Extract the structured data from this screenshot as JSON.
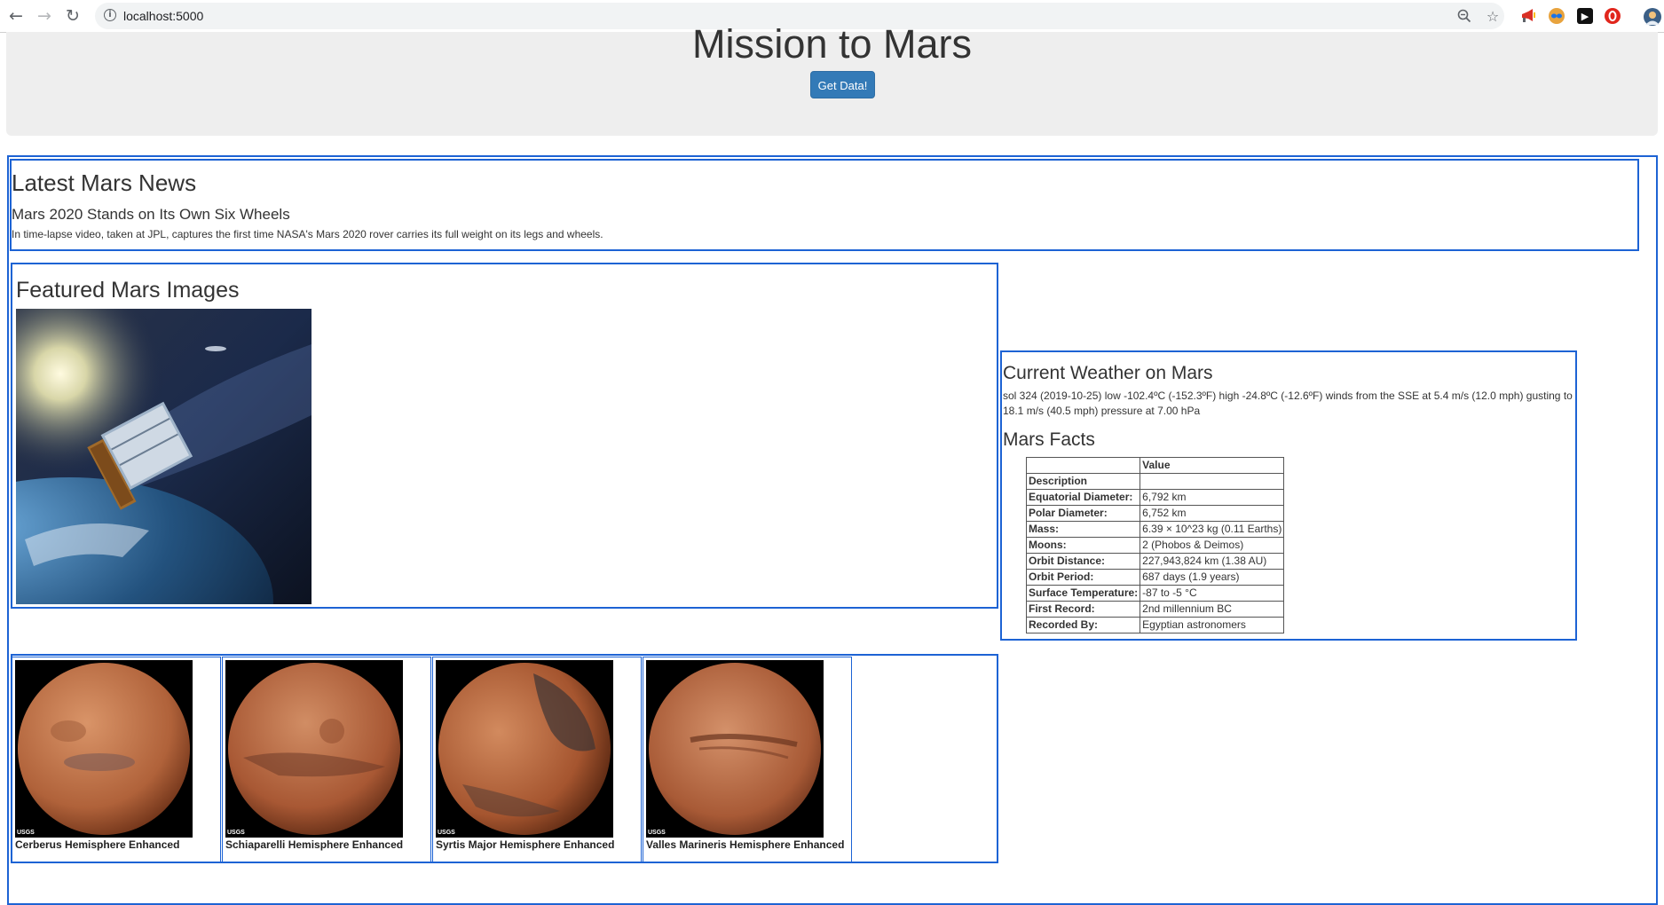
{
  "browser": {
    "url": "localhost:5000",
    "icons": [
      "back-icon",
      "forward-icon",
      "reload-icon",
      "site-info-icon",
      "zoom-icon",
      "bookmark-star-icon"
    ],
    "extensions": [
      "megaphone-extension-icon",
      "mask-extension-icon",
      "youtube-extension-icon",
      "opera-extension-icon",
      "profile-avatar-icon"
    ]
  },
  "header": {
    "title": "Mission to Mars",
    "button_label": "Get Data!",
    "button_color": "#337ab7"
  },
  "news": {
    "heading": "Latest Mars News",
    "title": "Mars 2020 Stands on Its Own Six Wheels",
    "paragraph": "In time-lapse video, taken at JPL, captures the first time NASA's Mars 2020 rover carries its full weight on its legs and wheels."
  },
  "featured": {
    "heading": "Featured Mars Images"
  },
  "weather": {
    "heading": "Current Weather on Mars",
    "text": "sol 324 (2019-10-25) low -102.4ºC (-152.3ºF) high -24.8ºC (-12.6ºF) winds from the SSE at 5.4 m/s (12.0 mph) gusting to 18.1 m/s (40.5 mph) pressure at 7.00 hPa"
  },
  "facts": {
    "heading": "Mars Facts",
    "column_header": "Value",
    "index_label": "Description",
    "rows": [
      {
        "key": "Equatorial Diameter:",
        "value": "6,792 km"
      },
      {
        "key": "Polar Diameter:",
        "value": "6,752 km"
      },
      {
        "key": "Mass:",
        "value": "6.39 × 10^23 kg (0.11 Earths)"
      },
      {
        "key": "Moons:",
        "value": "2 (Phobos & Deimos)"
      },
      {
        "key": "Orbit Distance:",
        "value": "227,943,824 km (1.38 AU)"
      },
      {
        "key": "Orbit Period:",
        "value": "687 days (1.9 years)"
      },
      {
        "key": "Surface Temperature:",
        "value": "-87 to -5 °C"
      },
      {
        "key": "First Record:",
        "value": "2nd millennium BC"
      },
      {
        "key": "Recorded By:",
        "value": "Egyptian astronomers"
      }
    ]
  },
  "hemispheres": [
    {
      "title": "Cerberus Hemisphere Enhanced",
      "logo": "USGS"
    },
    {
      "title": "Schiaparelli Hemisphere Enhanced",
      "logo": "USGS"
    },
    {
      "title": "Syrtis Major Hemisphere Enhanced",
      "logo": "USGS"
    },
    {
      "title": "Valles Marineris Hemisphere Enhanced",
      "logo": "USGS"
    }
  ],
  "colors": {
    "accent_border": "#1d63d4",
    "jumbotron_bg": "#eeeeee"
  }
}
